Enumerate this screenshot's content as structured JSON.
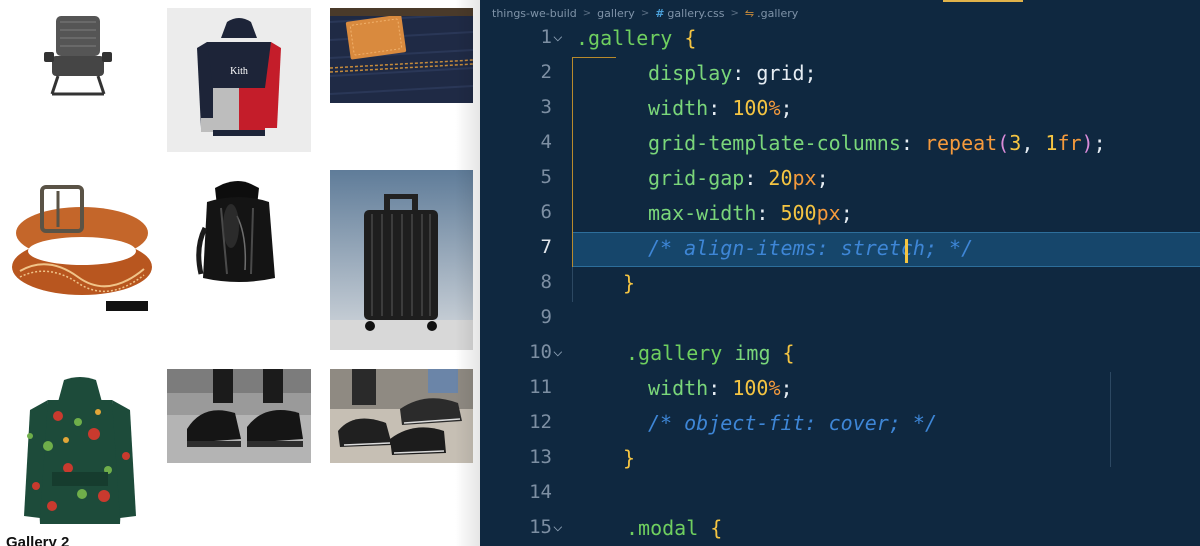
{
  "gallery": {
    "heading": "Gallery 2",
    "images": [
      {
        "subject": "folding-chair"
      },
      {
        "subject": "hoodie"
      },
      {
        "subject": "denim-jeans"
      },
      {
        "subject": "leather-belt"
      },
      {
        "subject": "backpack"
      },
      {
        "subject": "suitcase"
      },
      {
        "subject": "floral-jacket"
      },
      {
        "subject": "sneakers-pair"
      },
      {
        "subject": "sneakers-street"
      }
    ],
    "hoodie_logo": "Kith"
  },
  "editor": {
    "breadcrumb": {
      "folder1": "things-we-build",
      "folder2": "gallery",
      "file": "gallery.css",
      "symbol": ".gallery"
    },
    "colors": {
      "background": "#0f2840",
      "selector": "#6fcf5f",
      "brace": "#f5c542",
      "comment": "#3e86d6",
      "cursor": "#f5c542"
    },
    "lines": [
      {
        "n": "1",
        "fold": "⌵",
        "tokens": [
          {
            "c": "t-sel",
            "t": ".gallery "
          },
          {
            "c": "t-brace",
            "t": "{"
          }
        ]
      },
      {
        "n": "2",
        "tokens": [
          {
            "c": "t-prop",
            "t": "display"
          },
          {
            "c": "t-colon",
            "t": ": grid;"
          }
        ]
      },
      {
        "n": "3",
        "tokens": [
          {
            "c": "t-prop",
            "t": "width"
          },
          {
            "c": "t-colon",
            "t": ": "
          },
          {
            "c": "t-num",
            "t": "100"
          },
          {
            "c": "t-unit",
            "t": "%"
          },
          {
            "c": "t-punct",
            "t": ";"
          }
        ]
      },
      {
        "n": "4",
        "tokens": [
          {
            "c": "t-prop",
            "t": "grid-template-columns"
          },
          {
            "c": "t-colon",
            "t": ": "
          },
          {
            "c": "t-fn",
            "t": "repeat"
          },
          {
            "c": "t-paren",
            "t": "("
          },
          {
            "c": "t-num",
            "t": "3"
          },
          {
            "c": "t-punct",
            "t": ", "
          },
          {
            "c": "t-num",
            "t": "1"
          },
          {
            "c": "t-unit",
            "t": "fr"
          },
          {
            "c": "t-paren",
            "t": ")"
          },
          {
            "c": "t-punct",
            "t": ";"
          }
        ]
      },
      {
        "n": "5",
        "tokens": [
          {
            "c": "t-prop",
            "t": "grid-gap"
          },
          {
            "c": "t-colon",
            "t": ": "
          },
          {
            "c": "t-num",
            "t": "20"
          },
          {
            "c": "t-unit",
            "t": "px"
          },
          {
            "c": "t-punct",
            "t": ";"
          }
        ]
      },
      {
        "n": "6",
        "tokens": [
          {
            "c": "t-prop",
            "t": "max-width"
          },
          {
            "c": "t-colon",
            "t": ": "
          },
          {
            "c": "t-num",
            "t": "500"
          },
          {
            "c": "t-unit",
            "t": "px"
          },
          {
            "c": "t-punct",
            "t": ";"
          }
        ]
      },
      {
        "n": "7",
        "active": true,
        "tokens": [
          {
            "c": "t-com",
            "t": "/* align-items: stretch; */"
          }
        ]
      },
      {
        "n": "8",
        "tokens": [
          {
            "c": "t-brace",
            "t": "}"
          }
        ]
      },
      {
        "n": "9",
        "tokens": []
      },
      {
        "n": "10",
        "fold": "⌵",
        "tokens": [
          {
            "c": "t-sel",
            "t": ".gallery "
          },
          {
            "c": "t-prop",
            "t": "img "
          },
          {
            "c": "t-brace",
            "t": "{"
          }
        ]
      },
      {
        "n": "11",
        "tokens": [
          {
            "c": "t-prop",
            "t": "width"
          },
          {
            "c": "t-colon",
            "t": ": "
          },
          {
            "c": "t-num",
            "t": "100"
          },
          {
            "c": "t-unit",
            "t": "%"
          },
          {
            "c": "t-punct",
            "t": ";"
          }
        ]
      },
      {
        "n": "12",
        "tokens": [
          {
            "c": "t-com",
            "t": "/* object-fit: cover; */"
          }
        ]
      },
      {
        "n": "13",
        "tokens": [
          {
            "c": "t-brace",
            "t": "}"
          }
        ]
      },
      {
        "n": "14",
        "tokens": []
      },
      {
        "n": "15",
        "fold": "⌵",
        "tokens": [
          {
            "c": "t-sel",
            "t": ".modal "
          },
          {
            "c": "t-brace",
            "t": "{"
          }
        ]
      }
    ]
  }
}
